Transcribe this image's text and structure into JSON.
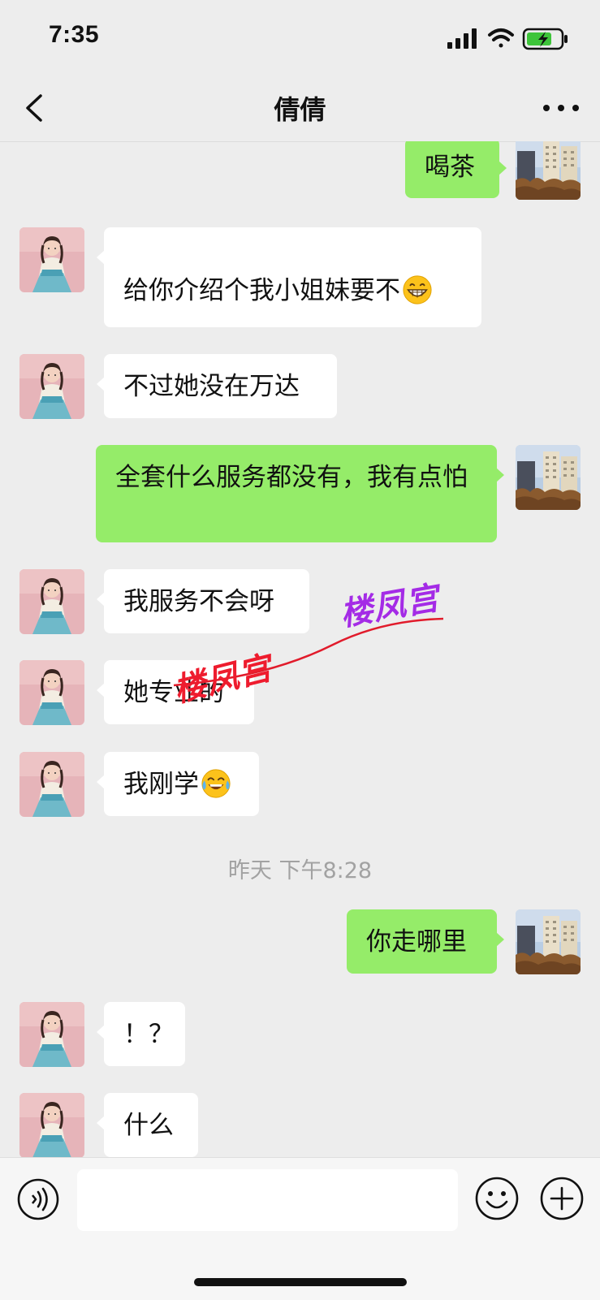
{
  "status_bar": {
    "time": "7:35"
  },
  "nav": {
    "title": "倩倩"
  },
  "messages": [
    {
      "side": "out",
      "text": "喝茶"
    },
    {
      "side": "in",
      "text": "给你介绍个我小姐妹要不"
    },
    {
      "side": "in",
      "text": "不过她没在万达"
    },
    {
      "side": "out",
      "text": "全套什么服务都没有，我有点怕"
    },
    {
      "side": "in",
      "text": "我服务不会呀"
    },
    {
      "side": "in",
      "text": "她专业的"
    },
    {
      "side": "in",
      "text": "我刚学"
    },
    {
      "timestamp": "昨天 下午8:28"
    },
    {
      "side": "out",
      "text": "你走哪里"
    },
    {
      "side": "in",
      "text": "！？"
    },
    {
      "side": "in",
      "text": "什么"
    }
  ],
  "watermarks": [
    "楼凤宫",
    "楼凤宫"
  ],
  "icons": {
    "back": "chevron-left-icon",
    "more": "more-dots-icon",
    "voice": "voice-icon",
    "emoji": "emoji-icon",
    "plus": "plus-icon",
    "grin": "grinning-emoji",
    "tears_of_joy": "tears-of-joy-emoji"
  },
  "colors": {
    "outgoing_bubble": "#95ec69",
    "incoming_bubble": "#ffffff",
    "background": "#ededed",
    "watermark_red": "#ee1c2e",
    "watermark_purple": "#a42be6"
  }
}
